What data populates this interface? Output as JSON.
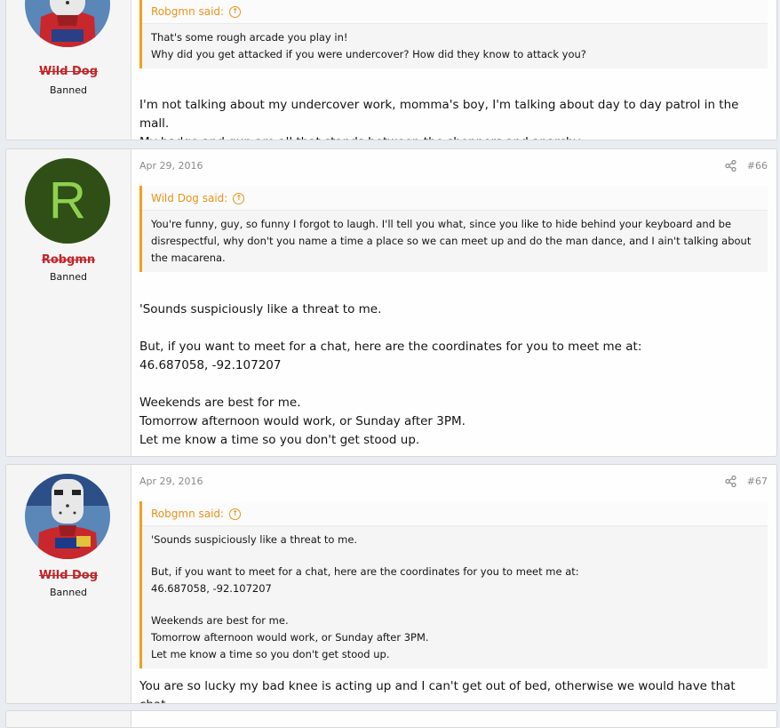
{
  "posts": [
    {
      "username": "Wild Dog",
      "usertitle": "Banned",
      "quote": {
        "author_label": "Robgmn said:",
        "lines": [
          "That's some rough arcade you play in!",
          "Why did you get attacked if you were undercover? How did they know to attack you?"
        ]
      },
      "message": {
        "lines": [
          "I'm not talking about my undercover work, momma's boy, I'm talking about day to day patrol in the mall.",
          "My badge and gun are all that stands between the shoppers and anarchy."
        ]
      }
    },
    {
      "username": "Robgmn",
      "usertitle": "Banned",
      "avatar_letter": "R",
      "date": "Apr 29, 2016",
      "post_number": "#66",
      "quote": {
        "author_label": "Wild Dog said:",
        "lines": [
          "You're funny, guy, so funny I forgot to laugh. I'll tell you what, since you like to hide behind your keyboard and be",
          "disrespectful, why don't you name a time a place so we can meet up and do the man dance, and I ain't talking about",
          "the macarena."
        ]
      },
      "message": {
        "lines": [
          "'Sounds suspiciously like a threat to me.",
          "But, if you want to meet for a chat, here are the coordinates for you to meet me at:",
          "46.687058, -92.107207",
          "Weekends are best for me.",
          "Tomorrow afternoon would work, or Sunday after 3PM.",
          "Let me know a time so you don't get stood up."
        ]
      }
    },
    {
      "username": "Wild Dog",
      "usertitle": "Banned",
      "date": "Apr 29, 2016",
      "post_number": "#67",
      "quote": {
        "author_label": "Robgmn said:",
        "lines": [
          "'Sounds suspiciously like a threat to me.",
          "But, if you want to meet for a chat, here are the coordinates for you to meet me at:",
          "46.687058, -92.107207",
          "Weekends are best for me.",
          "Tomorrow afternoon would work, or Sunday after 3PM.",
          "Let me know a time so you don't get stood up."
        ]
      },
      "message": {
        "lines": [
          "You are so lucky my bad knee is acting up and I can't get out of bed, otherwise we would have that chat."
        ]
      }
    }
  ]
}
